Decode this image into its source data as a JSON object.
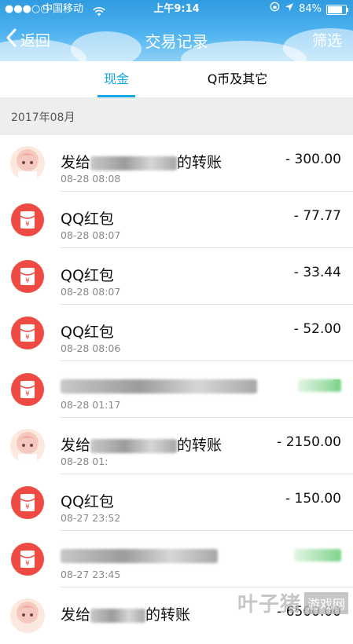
{
  "status_bar": {
    "signal_dots": "●●●○○",
    "carrier": "中国移动",
    "time": "上午9:14",
    "battery_percent": "84%",
    "battery_level": 0.84
  },
  "nav": {
    "back_label": "返回",
    "title": "交易记录",
    "filter_label": "筛选"
  },
  "tabs": [
    {
      "label": "现金",
      "active": true
    },
    {
      "label": "Q币及其它",
      "active": false
    }
  ],
  "month_header": "2017年08月",
  "transactions": [
    {
      "type": "transfer",
      "title_prefix": "发给",
      "title_suffix": "的转账",
      "time": "08-28 08:08",
      "amount": "- 300.00"
    },
    {
      "type": "redpacket",
      "title": "QQ红包",
      "time": "08-28 08:07",
      "amount": "- 77.77"
    },
    {
      "type": "redpacket",
      "title": "QQ红包",
      "time": "08-28 08:07",
      "amount": "- 33.44"
    },
    {
      "type": "redpacket",
      "title": "QQ红包",
      "time": "08-28 08:06",
      "amount": "- 52.00"
    },
    {
      "type": "redpacket_blurred",
      "time": "08-28 01:17",
      "amount": "7"
    },
    {
      "type": "transfer",
      "title_prefix": "发给",
      "title_suffix": "的转账",
      "time": "08-28 01:",
      "amount": "- 2150.00"
    },
    {
      "type": "redpacket",
      "title": "QQ红包",
      "time": "08-27 23:52",
      "amount": "- 150.00"
    },
    {
      "type": "redpacket_blurred",
      "time": "08-27 23:45",
      "amount": ""
    },
    {
      "type": "transfer",
      "title_prefix": "发给",
      "title_suffix": "的转账",
      "time": "",
      "amount": "- 6500.00"
    }
  ],
  "watermark": {
    "text": "叶子猪",
    "box": "游戏网"
  }
}
